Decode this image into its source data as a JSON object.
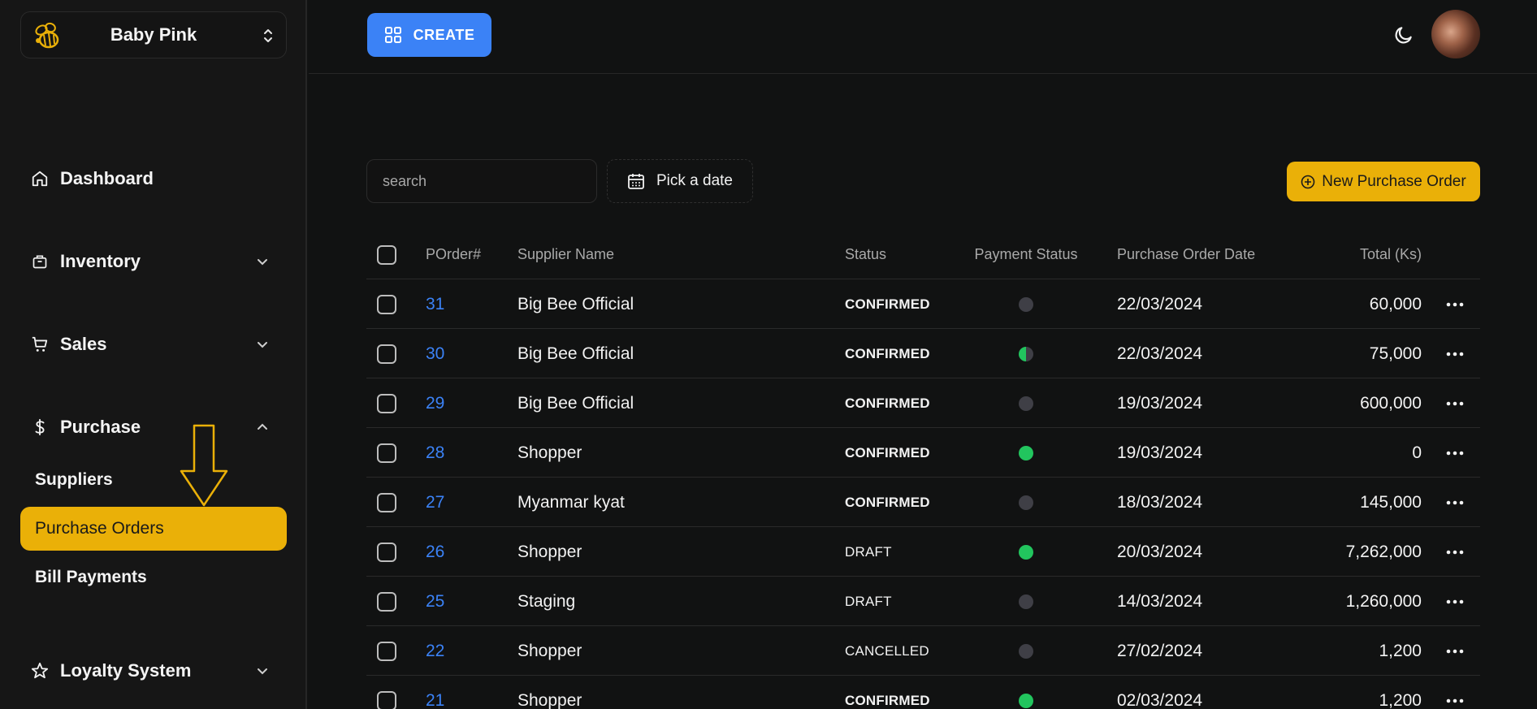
{
  "store": {
    "name": "Baby Pink",
    "logo_icon": "bee-logo-icon"
  },
  "nav": {
    "dashboard": "Dashboard",
    "inventory": "Inventory",
    "sales": "Sales",
    "purchase": "Purchase",
    "purchase_sub": [
      "Suppliers",
      "Purchase Orders",
      "Bill Payments"
    ],
    "loyalty": "Loyalty System"
  },
  "topbar": {
    "create_label": "CREATE"
  },
  "toolbar": {
    "search_placeholder": "search",
    "date_label": "Pick a date",
    "new_po_label": "New Purchase Order"
  },
  "colors": {
    "accent_yellow": "#eab008",
    "accent_blue": "#3b82f6",
    "paid_green": "#22c55e",
    "unpaid_gray": "#3f3f46",
    "cancelled_red": "#ef4444"
  },
  "table": {
    "headers": {
      "number": "POrder#",
      "supplier": "Supplier Name",
      "status": "Status",
      "payment": "Payment Status",
      "date": "Purchase Order Date",
      "total": "Total (Ks)"
    },
    "rows": [
      {
        "number": "31",
        "supplier": "Big Bee Official",
        "status": "CONFIRMED",
        "payment": "unpaid",
        "date": "22/03/2024",
        "total": "60,000"
      },
      {
        "number": "30",
        "supplier": "Big Bee Official",
        "status": "CONFIRMED",
        "payment": "partial",
        "date": "22/03/2024",
        "total": "75,000"
      },
      {
        "number": "29",
        "supplier": "Big Bee Official",
        "status": "CONFIRMED",
        "payment": "unpaid",
        "date": "19/03/2024",
        "total": "600,000"
      },
      {
        "number": "28",
        "supplier": "Shopper",
        "status": "CONFIRMED",
        "payment": "paid",
        "date": "19/03/2024",
        "total": "0"
      },
      {
        "number": "27",
        "supplier": "Myanmar kyat",
        "status": "CONFIRMED",
        "payment": "unpaid",
        "date": "18/03/2024",
        "total": "145,000"
      },
      {
        "number": "26",
        "supplier": "Shopper",
        "status": "DRAFT",
        "payment": "paid",
        "date": "20/03/2024",
        "total": "7,262,000"
      },
      {
        "number": "25",
        "supplier": "Staging",
        "status": "DRAFT",
        "payment": "unpaid",
        "date": "14/03/2024",
        "total": "1,260,000"
      },
      {
        "number": "22",
        "supplier": "Shopper",
        "status": "CANCELLED",
        "payment": "unpaid",
        "date": "27/02/2024",
        "total": "1,200"
      },
      {
        "number": "21",
        "supplier": "Shopper",
        "status": "CONFIRMED",
        "payment": "paid",
        "date": "02/03/2024",
        "total": "1,200"
      }
    ]
  }
}
